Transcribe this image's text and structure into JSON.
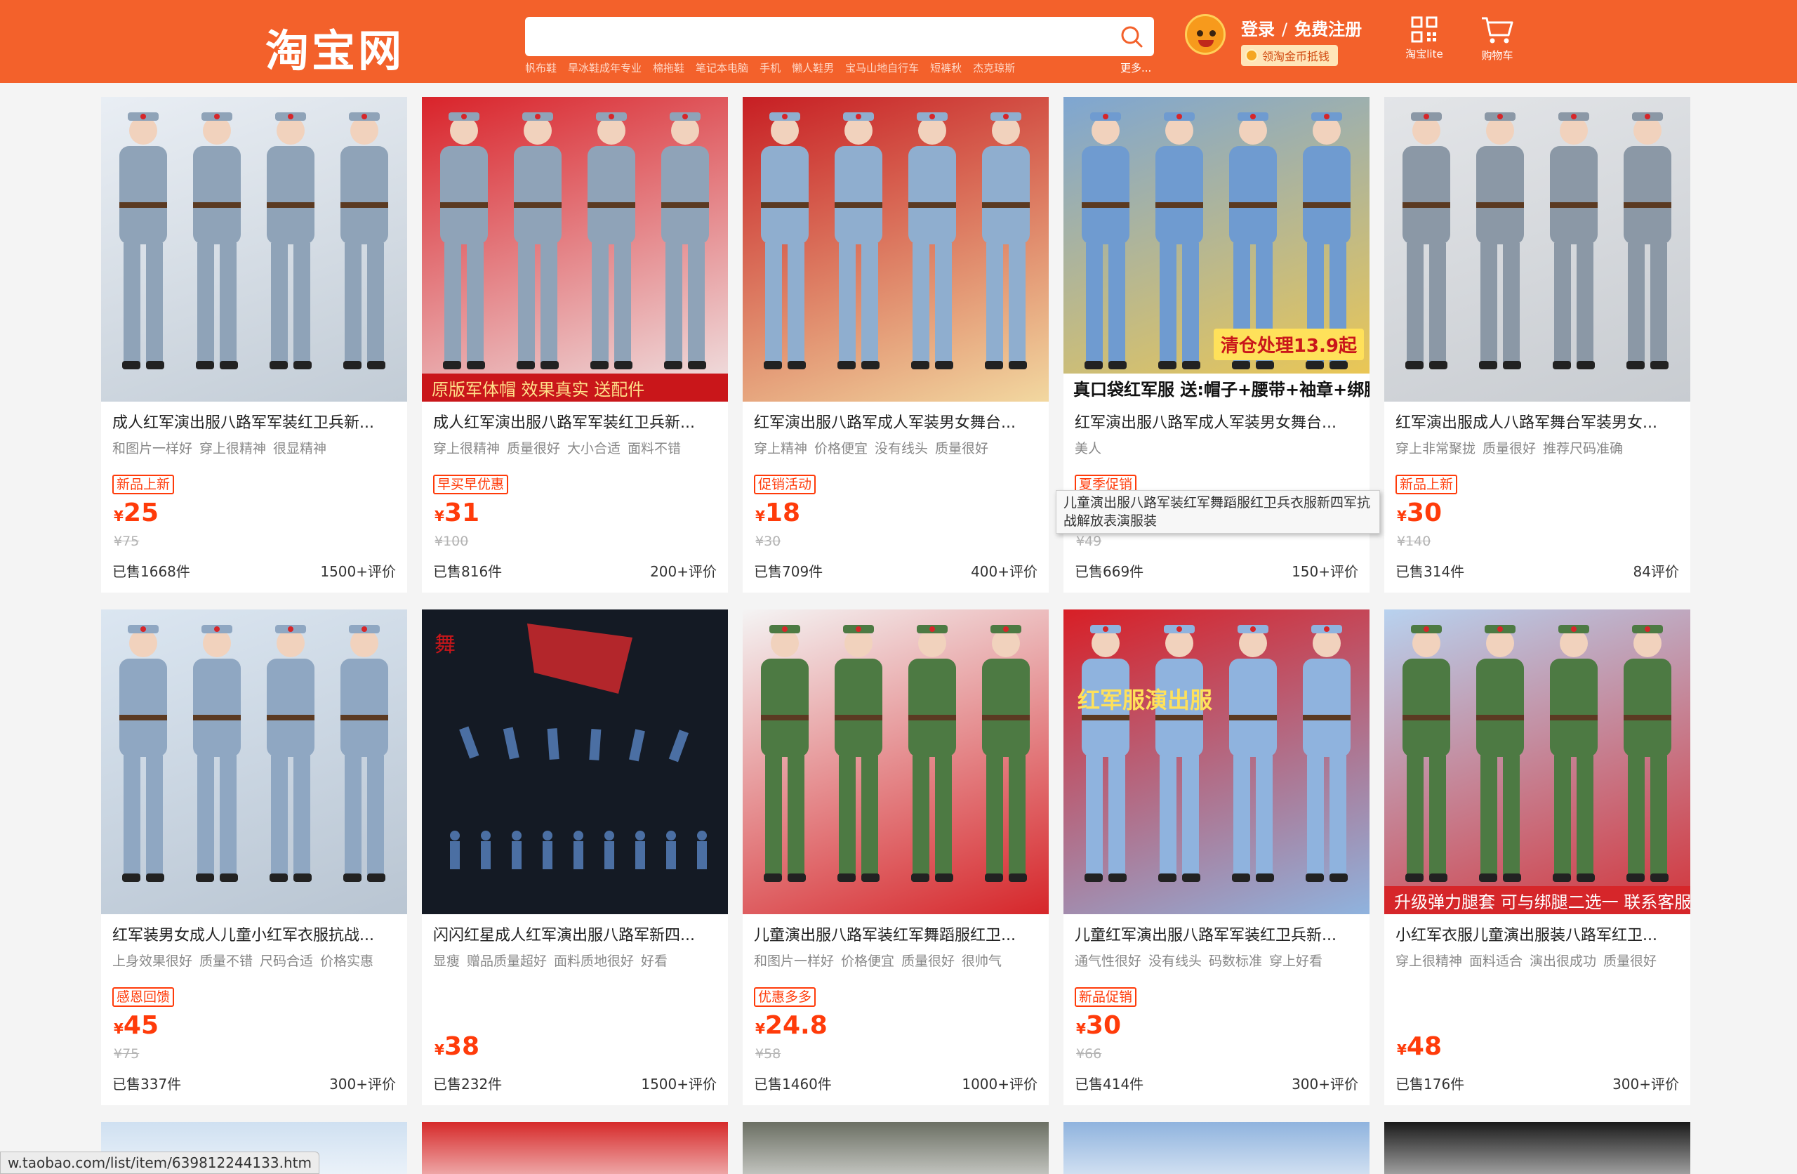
{
  "header": {
    "logo_text": "淘宝网",
    "search": {
      "value": "",
      "placeholder": ""
    },
    "hot_words": [
      "帆布鞋",
      "旱冰鞋成年专业",
      "棉拖鞋",
      "笔记本电脑",
      "手机",
      "懒人鞋男",
      "宝马山地自行车",
      "短裤秋",
      "杰克琼斯"
    ],
    "hot_more": "更多...",
    "login_label": "登录",
    "separator": "/",
    "register_label": "免费注册",
    "coin_label": "领淘金币抵钱",
    "lite_label": "淘宝lite",
    "cart_label": "购物车",
    "accent_color": "#f3612b"
  },
  "products": [
    {
      "title": "成人红军演出服八路军军装红卫兵新...",
      "tags": [
        "和图片一样好",
        "穿上很精神",
        "很显精神"
      ],
      "promo": "新品上新",
      "price": "25",
      "orig": "¥75",
      "sold": "已售1668件",
      "reviews": "1500+评价"
    },
    {
      "title": "成人红军演出服八路军军装红卫兵新...",
      "tags": [
        "穿上很精神",
        "质量很好",
        "大小合适",
        "面料不错"
      ],
      "promo": "早买早优惠",
      "price": "31",
      "orig": "¥100",
      "sold": "已售816件",
      "reviews": "200+评价",
      "banner": "原版军体帽   效果真实   送配件"
    },
    {
      "title": "红军演出服八路军成人军装男女舞台...",
      "tags": [
        "穿上精神",
        "价格便宜",
        "没有线头",
        "质量很好"
      ],
      "promo": "促销活动",
      "price": "18",
      "orig": "¥30",
      "sold": "已售709件",
      "reviews": "400+评价"
    },
    {
      "title": "红军演出服八路军成人军装男女舞台...",
      "tags": [
        "美人"
      ],
      "promo": "夏季促销",
      "price": "",
      "orig": "¥49",
      "sold": "已售669件",
      "reviews": "150+评价",
      "badge": "清仓处理13.9起",
      "banner": "真口袋红军服  送:帽子+腰带+袖章+绑腿"
    },
    {
      "title": "红军演出服成人八路军舞台军装男女...",
      "tags": [
        "穿上非常聚拢",
        "质量很好",
        "推荐尺码准确"
      ],
      "promo": "新品上新",
      "price": "30",
      "orig": "¥140",
      "sold": "已售314件",
      "reviews": "84评价"
    },
    {
      "title": "红军装男女成人儿童小红军衣服抗战...",
      "tags": [
        "上身效果很好",
        "质量不错",
        "尺码合适",
        "价格实惠"
      ],
      "promo": "感恩回馈",
      "price": "45",
      "orig": "¥75",
      "sold": "已售337件",
      "reviews": "300+评价"
    },
    {
      "title": "闪闪红星成人红军演出服八路军新四...",
      "tags": [
        "显瘦",
        "赠品质量超好",
        "面料质地很好",
        "好看"
      ],
      "promo": "",
      "price": "38",
      "orig": "",
      "sold": "已售232件",
      "reviews": "1500+评价"
    },
    {
      "title": "儿童演出服八路军装红军舞蹈服红卫...",
      "tags": [
        "和图片一样好",
        "价格便宜",
        "质量很好",
        "很帅气"
      ],
      "promo": "优惠多多",
      "price": "24.8",
      "orig": "¥58",
      "sold": "已售1460件",
      "reviews": "1000+评价"
    },
    {
      "title": "儿童红军演出服八路军军装红卫兵新...",
      "tags": [
        "通气性很好",
        "没有线头",
        "码数标准",
        "穿上好看"
      ],
      "promo": "新品促销",
      "price": "30",
      "orig": "¥66",
      "sold": "已售414件",
      "reviews": "300+评价",
      "badge": "红军服演出服"
    },
    {
      "title": "小红军衣服儿童演出服装八路军红卫...",
      "tags": [
        "穿上很精神",
        "面料适合",
        "演出很成功",
        "质量很好"
      ],
      "promo": "",
      "price": "48",
      "orig": "",
      "sold": "已售176件",
      "reviews": "300+评价",
      "banner": "升级弹力腿套  可与绑腿二选一  联系客服备注"
    }
  ],
  "currency_symbol": "¥",
  "tooltip_text": "儿童演出服八路军装红军舞蹈服红卫兵衣服新四军抗战解放表演服装",
  "status_url": "w.taobao.com/list/item/639812244133.htm"
}
